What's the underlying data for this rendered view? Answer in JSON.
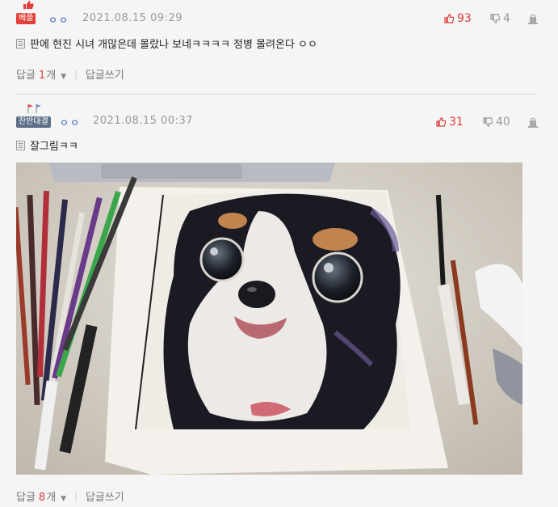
{
  "comments": [
    {
      "badge": "베플",
      "author": "ㅇㅇ",
      "date": "2021.08.15 09:29",
      "upvotes": "93",
      "downvotes": "4",
      "text": "판에 현진 시녀 개많은데 몰랐나 보네ㅋㅋㅋㅋ 정병 몰려온다 ㅇㅇ",
      "reply_label": "답글",
      "reply_count": "1",
      "reply_unit": "개",
      "write_reply": "답글쓰기"
    },
    {
      "badge": "찬반대결",
      "author": "ㅇㅇ",
      "date": "2021.08.15 00:37",
      "upvotes": "31",
      "downvotes": "40",
      "text": "잘그림ㅋㅋ",
      "reply_label": "답글",
      "reply_count": "8",
      "reply_unit": "개",
      "write_reply": "답글쓰기"
    }
  ],
  "colors": {
    "upvote": "#e03a3a",
    "author": "#2d58b8",
    "badge_best": "#e3403b",
    "badge_hot": "#5b6f88"
  },
  "icons": [
    "thumbs-up-icon",
    "thumbs-down-icon",
    "report-icon",
    "memo-icon",
    "chevron-down-icon",
    "flags-icon"
  ]
}
